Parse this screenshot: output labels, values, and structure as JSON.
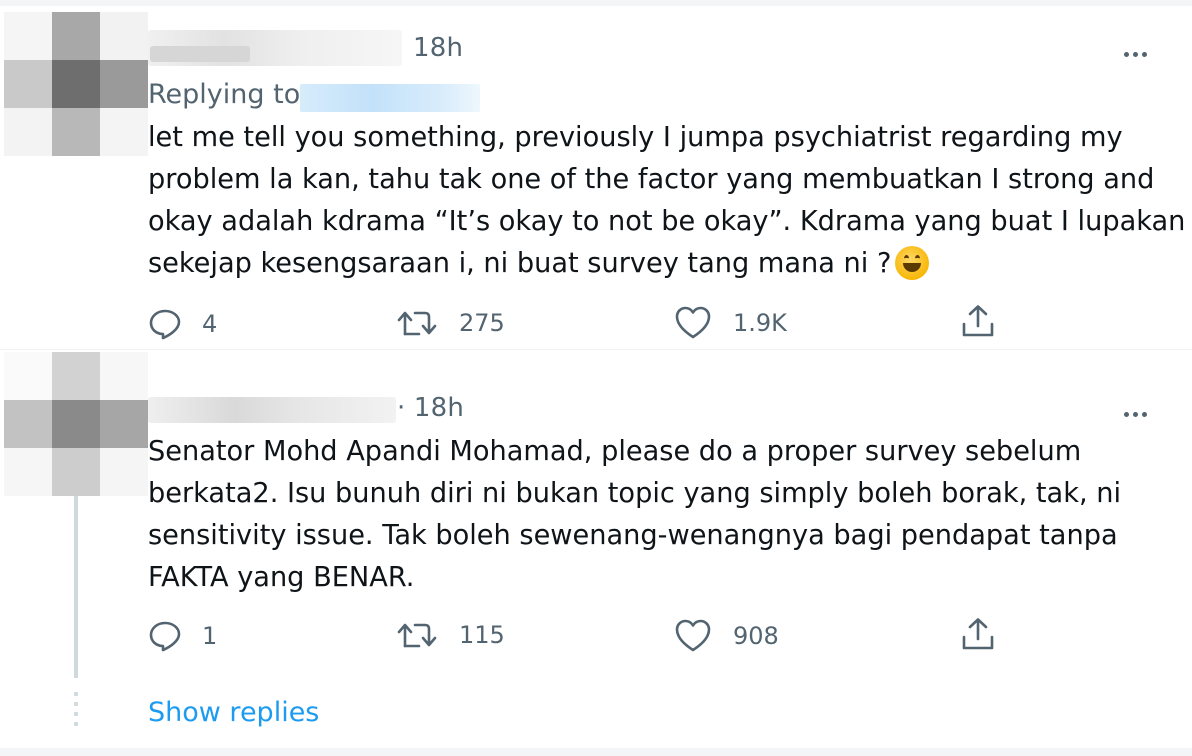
{
  "tweets": [
    {
      "time": "18h",
      "replying_label": "Replying to",
      "text": "let me tell you something, previously I jumpa psychiatrist regarding my\nproblem la kan, tahu tak one of the factor yang membuatkan I strong and\nokay adalah kdrama “It’s okay to not be okay”. Kdrama yang buat I lupakan\nsekejap kesengsaraan i, ni buat survey tang mana ni ?",
      "emoji": "grinning-squinting-face",
      "actions": {
        "reply": "4",
        "retweet": "275",
        "like": "1.9K"
      }
    },
    {
      "time": "· 18h",
      "text": "Senator Mohd Apandi Mohamad, please do a proper survey sebelum\nberkata2. Isu bunuh diri ni bukan topic yang simply boleh borak, tak, ni\nsensitivity issue. Tak boleh sewenang-wenangnya bagi pendapat tanpa\nFAKTA yang BENAR.",
      "actions": {
        "reply": "1",
        "retweet": "115",
        "like": "908"
      }
    }
  ],
  "show_replies": "Show replies",
  "icons": [
    "reply-icon",
    "retweet-icon",
    "like-icon",
    "share-icon",
    "more-options-icon"
  ],
  "colors": {
    "link": "#1d9bf0",
    "secondary": "#536471",
    "text": "#0f1419"
  }
}
